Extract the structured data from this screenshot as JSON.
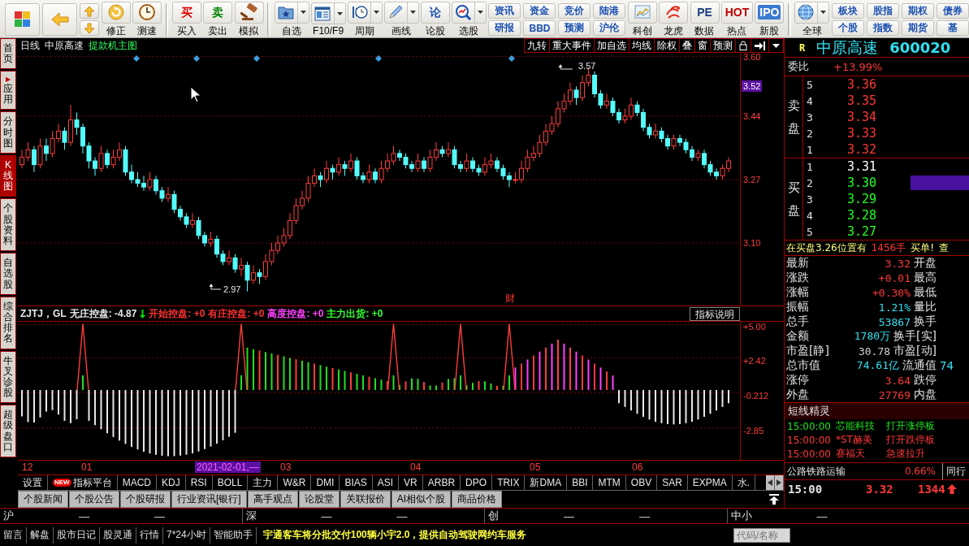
{
  "toolbar": {
    "sections": [
      [
        {
          "kind": "icon",
          "label": "修正"
        },
        {
          "kind": "icon",
          "label": "测速"
        }
      ],
      [
        {
          "kind": "glyph",
          "glyph": "买",
          "color": "#e00000",
          "label": "买入"
        },
        {
          "kind": "glyph",
          "glyph": "卖",
          "color": "#008000",
          "label": "卖出"
        },
        {
          "kind": "icon",
          "label": "模拟"
        }
      ],
      [
        {
          "kind": "dropdown",
          "label": "自选"
        },
        {
          "kind": "dropdown",
          "label": "F10/F9"
        },
        {
          "kind": "dropdown",
          "label": "周期"
        },
        {
          "kind": "dropdown",
          "label": "画线"
        },
        {
          "kind": "glyph",
          "glyph": "论",
          "color": "#1a4fb0",
          "label": "论股"
        },
        {
          "kind": "dropdown",
          "label": "选股"
        },
        {
          "kind": "pair",
          "labels": [
            "资讯",
            "研报"
          ]
        },
        {
          "kind": "pair",
          "labels": [
            "资金",
            "BBD"
          ]
        },
        {
          "kind": "pair",
          "labels": [
            "竞价",
            "预测"
          ]
        },
        {
          "kind": "pair",
          "labels": [
            "陆港",
            "沪伦"
          ]
        },
        {
          "kind": "icon",
          "label": "科创"
        },
        {
          "kind": "icon",
          "label": "龙虎"
        },
        {
          "kind": "glyph",
          "glyph": "PE",
          "color": "#1a3f80",
          "label": "数据"
        },
        {
          "kind": "glyph",
          "glyph": "HOT",
          "color": "#c00000",
          "label": "热点"
        },
        {
          "kind": "tile",
          "glyph": "IPO",
          "color": "#3a7ad0",
          "label": "新股"
        }
      ],
      [
        {
          "kind": "dropdown",
          "label": "全球"
        },
        {
          "kind": "pair",
          "labels": [
            "板块",
            "个股"
          ]
        },
        {
          "kind": "pair",
          "labels": [
            "股指",
            "指数"
          ]
        },
        {
          "kind": "pair",
          "labels": [
            "期权",
            "期货"
          ]
        },
        {
          "kind": "pair",
          "labels": [
            "债券",
            "基"
          ]
        }
      ]
    ]
  },
  "sidebar": [
    {
      "label": "首页",
      "selected": false
    },
    {
      "label": "应用",
      "arrow": "▶",
      "selected": false
    },
    {
      "label": "分时图",
      "selected": false
    },
    {
      "label": "K线图",
      "selected": true
    },
    {
      "label": "个股资料",
      "selected": false
    },
    {
      "label": "自选股",
      "selected": false
    },
    {
      "label": "综合排名",
      "selected": false
    },
    {
      "label": "牛叉诊股",
      "selected": false
    },
    {
      "label": "超级盘口",
      "selected": false
    }
  ],
  "chart_header": {
    "period": "日线",
    "stock": "中原高速",
    "formula": "提款机主图",
    "buttons": [
      "九转",
      "重大事件",
      "加自选",
      "均线",
      "除权",
      "叠",
      "窗",
      "预测"
    ]
  },
  "kline": {
    "chart_data": {
      "type": "candlestick",
      "grid": true,
      "ylim": [
        2.93,
        3.61
      ],
      "yticks": [
        {
          "value": 3.6,
          "label": "3.60"
        },
        {
          "value": 3.44,
          "label": "3.44"
        },
        {
          "value": 3.27,
          "label": "3.27"
        },
        {
          "value": 3.1,
          "label": "3.10"
        }
      ],
      "ohlc": [
        [
          3.31,
          3.35,
          3.3,
          3.33
        ],
        [
          3.33,
          3.37,
          3.32,
          3.35
        ],
        [
          3.35,
          3.36,
          3.29,
          3.31
        ],
        [
          3.31,
          3.38,
          3.3,
          3.36
        ],
        [
          3.36,
          3.38,
          3.32,
          3.34
        ],
        [
          3.34,
          3.4,
          3.33,
          3.38
        ],
        [
          3.38,
          3.42,
          3.37,
          3.4
        ],
        [
          3.4,
          3.41,
          3.35,
          3.37
        ],
        [
          3.37,
          3.47,
          3.36,
          3.43
        ],
        [
          3.43,
          3.45,
          3.39,
          3.41
        ],
        [
          3.41,
          3.42,
          3.34,
          3.36
        ],
        [
          3.36,
          3.37,
          3.3,
          3.32
        ],
        [
          3.32,
          3.33,
          3.28,
          3.3
        ],
        [
          3.3,
          3.36,
          3.29,
          3.34
        ],
        [
          3.34,
          3.35,
          3.3,
          3.31
        ],
        [
          3.31,
          3.35,
          3.3,
          3.33
        ],
        [
          3.33,
          3.37,
          3.32,
          3.35
        ],
        [
          3.35,
          3.36,
          3.28,
          3.29
        ],
        [
          3.29,
          3.31,
          3.26,
          3.27
        ],
        [
          3.27,
          3.29,
          3.25,
          3.26
        ],
        [
          3.26,
          3.28,
          3.24,
          3.25
        ],
        [
          3.25,
          3.29,
          3.24,
          3.27
        ],
        [
          3.27,
          3.28,
          3.23,
          3.24
        ],
        [
          3.24,
          3.25,
          3.21,
          3.22
        ],
        [
          3.22,
          3.25,
          3.21,
          3.23
        ],
        [
          3.23,
          3.24,
          3.18,
          3.19
        ],
        [
          3.19,
          3.2,
          3.16,
          3.17
        ],
        [
          3.17,
          3.18,
          3.14,
          3.15
        ],
        [
          3.15,
          3.18,
          3.14,
          3.16
        ],
        [
          3.16,
          3.17,
          3.11,
          3.12
        ],
        [
          3.12,
          3.13,
          3.09,
          3.1
        ],
        [
          3.1,
          3.13,
          3.09,
          3.11
        ],
        [
          3.11,
          3.12,
          3.06,
          3.07
        ],
        [
          3.07,
          3.08,
          3.04,
          3.05
        ],
        [
          3.05,
          3.08,
          3.04,
          3.06
        ],
        [
          3.06,
          3.07,
          3.02,
          3.03
        ],
        [
          3.03,
          3.06,
          3.01,
          3.04
        ],
        [
          3.04,
          3.05,
          2.97,
          3.0
        ],
        [
          3.0,
          3.04,
          2.99,
          3.02
        ],
        [
          3.02,
          3.03,
          2.99,
          3.01
        ],
        [
          3.01,
          3.07,
          3.0,
          3.05
        ],
        [
          3.05,
          3.1,
          3.04,
          3.08
        ],
        [
          3.08,
          3.12,
          3.07,
          3.1
        ],
        [
          3.1,
          3.14,
          3.09,
          3.12
        ],
        [
          3.12,
          3.18,
          3.11,
          3.16
        ],
        [
          3.16,
          3.22,
          3.15,
          3.2
        ],
        [
          3.2,
          3.24,
          3.19,
          3.22
        ],
        [
          3.22,
          3.28,
          3.21,
          3.26
        ],
        [
          3.26,
          3.3,
          3.25,
          3.28
        ],
        [
          3.28,
          3.29,
          3.25,
          3.27
        ],
        [
          3.27,
          3.32,
          3.26,
          3.3
        ],
        [
          3.3,
          3.31,
          3.27,
          3.29
        ],
        [
          3.29,
          3.33,
          3.28,
          3.31
        ],
        [
          3.31,
          3.32,
          3.28,
          3.3
        ],
        [
          3.3,
          3.34,
          3.29,
          3.32
        ],
        [
          3.32,
          3.33,
          3.27,
          3.28
        ],
        [
          3.28,
          3.29,
          3.26,
          3.27
        ],
        [
          3.27,
          3.31,
          3.26,
          3.29
        ],
        [
          3.29,
          3.3,
          3.26,
          3.27
        ],
        [
          3.27,
          3.32,
          3.26,
          3.3
        ],
        [
          3.3,
          3.34,
          3.29,
          3.32
        ],
        [
          3.32,
          3.36,
          3.31,
          3.34
        ],
        [
          3.34,
          3.35,
          3.32,
          3.33
        ],
        [
          3.33,
          3.34,
          3.3,
          3.31
        ],
        [
          3.31,
          3.32,
          3.29,
          3.3
        ],
        [
          3.3,
          3.34,
          3.29,
          3.32
        ],
        [
          3.32,
          3.33,
          3.29,
          3.3
        ],
        [
          3.3,
          3.35,
          3.29,
          3.33
        ],
        [
          3.33,
          3.37,
          3.32,
          3.35
        ],
        [
          3.35,
          3.36,
          3.33,
          3.34
        ],
        [
          3.34,
          3.37,
          3.33,
          3.35
        ],
        [
          3.35,
          3.36,
          3.3,
          3.31
        ],
        [
          3.31,
          3.32,
          3.29,
          3.3
        ],
        [
          3.3,
          3.34,
          3.29,
          3.32
        ],
        [
          3.32,
          3.33,
          3.29,
          3.3
        ],
        [
          3.3,
          3.31,
          3.28,
          3.29
        ],
        [
          3.29,
          3.33,
          3.28,
          3.31
        ],
        [
          3.31,
          3.34,
          3.3,
          3.32
        ],
        [
          3.32,
          3.33,
          3.29,
          3.3
        ],
        [
          3.3,
          3.31,
          3.27,
          3.28
        ],
        [
          3.28,
          3.29,
          3.25,
          3.27
        ],
        [
          3.27,
          3.29,
          3.26,
          3.27
        ],
        [
          3.27,
          3.32,
          3.26,
          3.3
        ],
        [
          3.3,
          3.35,
          3.29,
          3.33
        ],
        [
          3.33,
          3.36,
          3.32,
          3.34
        ],
        [
          3.34,
          3.39,
          3.33,
          3.37
        ],
        [
          3.37,
          3.42,
          3.36,
          3.4
        ],
        [
          3.4,
          3.44,
          3.39,
          3.42
        ],
        [
          3.42,
          3.48,
          3.41,
          3.46
        ],
        [
          3.46,
          3.5,
          3.45,
          3.48
        ],
        [
          3.48,
          3.53,
          3.47,
          3.51
        ],
        [
          3.51,
          3.52,
          3.47,
          3.49
        ],
        [
          3.49,
          3.55,
          3.48,
          3.53
        ],
        [
          3.53,
          3.57,
          3.52,
          3.55
        ],
        [
          3.55,
          3.56,
          3.49,
          3.5
        ],
        [
          3.5,
          3.51,
          3.46,
          3.47
        ],
        [
          3.47,
          3.5,
          3.46,
          3.48
        ],
        [
          3.48,
          3.49,
          3.44,
          3.45
        ],
        [
          3.45,
          3.46,
          3.42,
          3.43
        ],
        [
          3.43,
          3.46,
          3.42,
          3.44
        ],
        [
          3.44,
          3.49,
          3.43,
          3.47
        ],
        [
          3.47,
          3.48,
          3.44,
          3.45
        ],
        [
          3.45,
          3.46,
          3.4,
          3.41
        ],
        [
          3.41,
          3.42,
          3.38,
          3.39
        ],
        [
          3.39,
          3.42,
          3.38,
          3.4
        ],
        [
          3.4,
          3.41,
          3.37,
          3.38
        ],
        [
          3.38,
          3.39,
          3.35,
          3.36
        ],
        [
          3.36,
          3.39,
          3.35,
          3.38
        ],
        [
          3.38,
          3.39,
          3.36,
          3.37
        ],
        [
          3.37,
          3.38,
          3.34,
          3.35
        ],
        [
          3.35,
          3.36,
          3.32,
          3.33
        ],
        [
          3.33,
          3.35,
          3.32,
          3.34
        ],
        [
          3.34,
          3.35,
          3.3,
          3.31
        ],
        [
          3.31,
          3.32,
          3.28,
          3.29
        ],
        [
          3.29,
          3.3,
          3.27,
          3.28
        ],
        [
          3.28,
          3.31,
          3.27,
          3.3
        ],
        [
          3.3,
          3.33,
          3.29,
          3.32
        ]
      ]
    },
    "current_price": "3.52",
    "high_label": "3.57",
    "low_label": "2.97",
    "event_marker": "财"
  },
  "indicator": {
    "name": "ZJTJ，GL",
    "items": [
      {
        "text": "无庄控盘: -4.87",
        "color": "#e8e8e8",
        "kind": "down"
      },
      {
        "text": "开始控盘: +0",
        "color": "#ff3030",
        "kind": "plain"
      },
      {
        "text": "有庄控盘: +0",
        "color": "#ff3030",
        "kind": "plain"
      },
      {
        "text": "高度控盘: +0",
        "color": "#ff40ff",
        "kind": "plain"
      },
      {
        "text": "主力出货: +0",
        "color": "#30ff30",
        "kind": "plain"
      }
    ],
    "button": "指标说明",
    "ticks": [
      "+5.00",
      "+2.42",
      "-0.212",
      "-2.85"
    ]
  },
  "date_axis": [
    {
      "text": "12",
      "kind": "month"
    },
    {
      "text": "01",
      "kind": "month"
    },
    {
      "text": "2021-02-01,—",
      "kind": "cursor"
    },
    {
      "text": "03",
      "kind": "month"
    },
    {
      "text": "04",
      "kind": "month"
    },
    {
      "text": "05",
      "kind": "month"
    },
    {
      "text": "06",
      "kind": "month"
    }
  ],
  "indicator_tabs": [
    {
      "label": "设置"
    },
    {
      "label": "指标平台",
      "badge": "NEW"
    },
    {
      "label": "MACD"
    },
    {
      "label": "KDJ"
    },
    {
      "label": "RSI"
    },
    {
      "label": "BOLL"
    },
    {
      "label": "主力"
    },
    {
      "label": "W&R"
    },
    {
      "label": "DMI"
    },
    {
      "label": "BIAS"
    },
    {
      "label": "ASI"
    },
    {
      "label": "VR"
    },
    {
      "label": "ARBR"
    },
    {
      "label": "DPO"
    },
    {
      "label": "TRIX"
    },
    {
      "label": "新DMA"
    },
    {
      "label": "BBI"
    },
    {
      "label": "MTM"
    },
    {
      "label": "OBV"
    },
    {
      "label": "SAR"
    },
    {
      "label": "EXPMA"
    },
    {
      "label": "水."
    }
  ],
  "news_tabs": [
    "个股新闻",
    "个股公告",
    "个股研报",
    "行业资讯[银行]",
    "高手观点",
    "论股堂",
    "关联报价",
    "AI相似个股",
    "商品价格"
  ],
  "quote": {
    "flag": "R",
    "name": "中原高速",
    "code": "600020",
    "ratio_label": "委比",
    "ratio": "+13.99%",
    "sell_label": "卖盘",
    "buy_label": "买盘",
    "sell": [
      {
        "rank": "5",
        "price": "3.36",
        "color": "#ff3838"
      },
      {
        "rank": "4",
        "price": "3.35",
        "color": "#ff3838"
      },
      {
        "rank": "3",
        "price": "3.34",
        "color": "#ff3838"
      },
      {
        "rank": "2",
        "price": "3.33",
        "color": "#ff3838"
      },
      {
        "rank": "1",
        "price": "3.32",
        "color": "#ff3838"
      }
    ],
    "buy": [
      {
        "rank": "1",
        "price": "3.31",
        "color": "#ffffff"
      },
      {
        "rank": "2",
        "price": "3.30",
        "color": "#20ff20",
        "level": 1
      },
      {
        "rank": "3",
        "price": "3.29",
        "color": "#20ff20"
      },
      {
        "rank": "4",
        "price": "3.28",
        "color": "#20ff20"
      },
      {
        "rank": "5",
        "price": "3.27",
        "color": "#20ff20"
      }
    ],
    "notice": [
      "在买盘3.26位置有",
      "1456手",
      "买单!",
      "查"
    ],
    "stats": [
      {
        "label": "最新",
        "value": "3.32",
        "color": "#ff3838",
        "label2": "开盘"
      },
      {
        "label": "涨跌",
        "value": "+0.01",
        "color": "#ff3838",
        "label2": "最高"
      },
      {
        "label": "涨幅",
        "value": "+0.30%",
        "color": "#ff3838",
        "label2": "最低"
      },
      {
        "label": "振幅",
        "value": "1.21%",
        "color": "#30e0f0",
        "label2": "量比"
      },
      {
        "label": "总手",
        "value": "53867",
        "color": "#30e0f0",
        "label2": "换手"
      },
      {
        "label": "金额",
        "value": "1780万",
        "color": "#30e0f0",
        "label2": "换手[实]"
      },
      {
        "label": "市盈[静]",
        "value": "30.78",
        "color": "#d0d0d0",
        "label2": "市盈[动]"
      },
      {
        "label": "总市值",
        "value": "74.61亿",
        "color": "#30e0f0",
        "label2": "流通值",
        "value2": "74"
      },
      {
        "label": "涨停",
        "value": "3.64",
        "color": "#ff3838",
        "label2": "跌停"
      },
      {
        "label": "外盘",
        "value": "27769",
        "color": "#ff3838",
        "label2": "内盘"
      }
    ],
    "alerts_title": "短线精灵",
    "alerts": [
      {
        "time": "15:00:00",
        "stock": "芯能科技",
        "event": "打开涨停板",
        "color": "#20e020"
      },
      {
        "time": "15:00:00",
        "stock": "*ST赫美",
        "event": "打开跌停板",
        "color": "#ff3838"
      },
      {
        "time": "15:00:00",
        "stock": "赛福天",
        "event": "急速拉升",
        "color": "#ff3838"
      }
    ],
    "industry": "公路铁路运输",
    "industry_change": "0.66%",
    "industry_button": "同行",
    "last_time": "15:00",
    "last_price": "3.32",
    "last_volume": "1344"
  },
  "index_bar": [
    {
      "label": "沪",
      "values": [
        "—",
        "—"
      ]
    },
    {
      "label": "深",
      "values": [
        "—",
        "—"
      ]
    },
    {
      "label": "创",
      "values": [
        "—",
        "—"
      ]
    },
    {
      "label": "中小",
      "values": [
        "—"
      ]
    }
  ],
  "status_bar": {
    "tabs": [
      "留言",
      "解盘",
      "股市日记",
      "股灵通",
      "行情",
      "7*24小时",
      "智能助手"
    ],
    "ticker": "宇通客车将分批交付100辆小宇2.0，提供自动驾驶网约车服务",
    "search": {
      "placeholder": "代码/名称"
    }
  }
}
